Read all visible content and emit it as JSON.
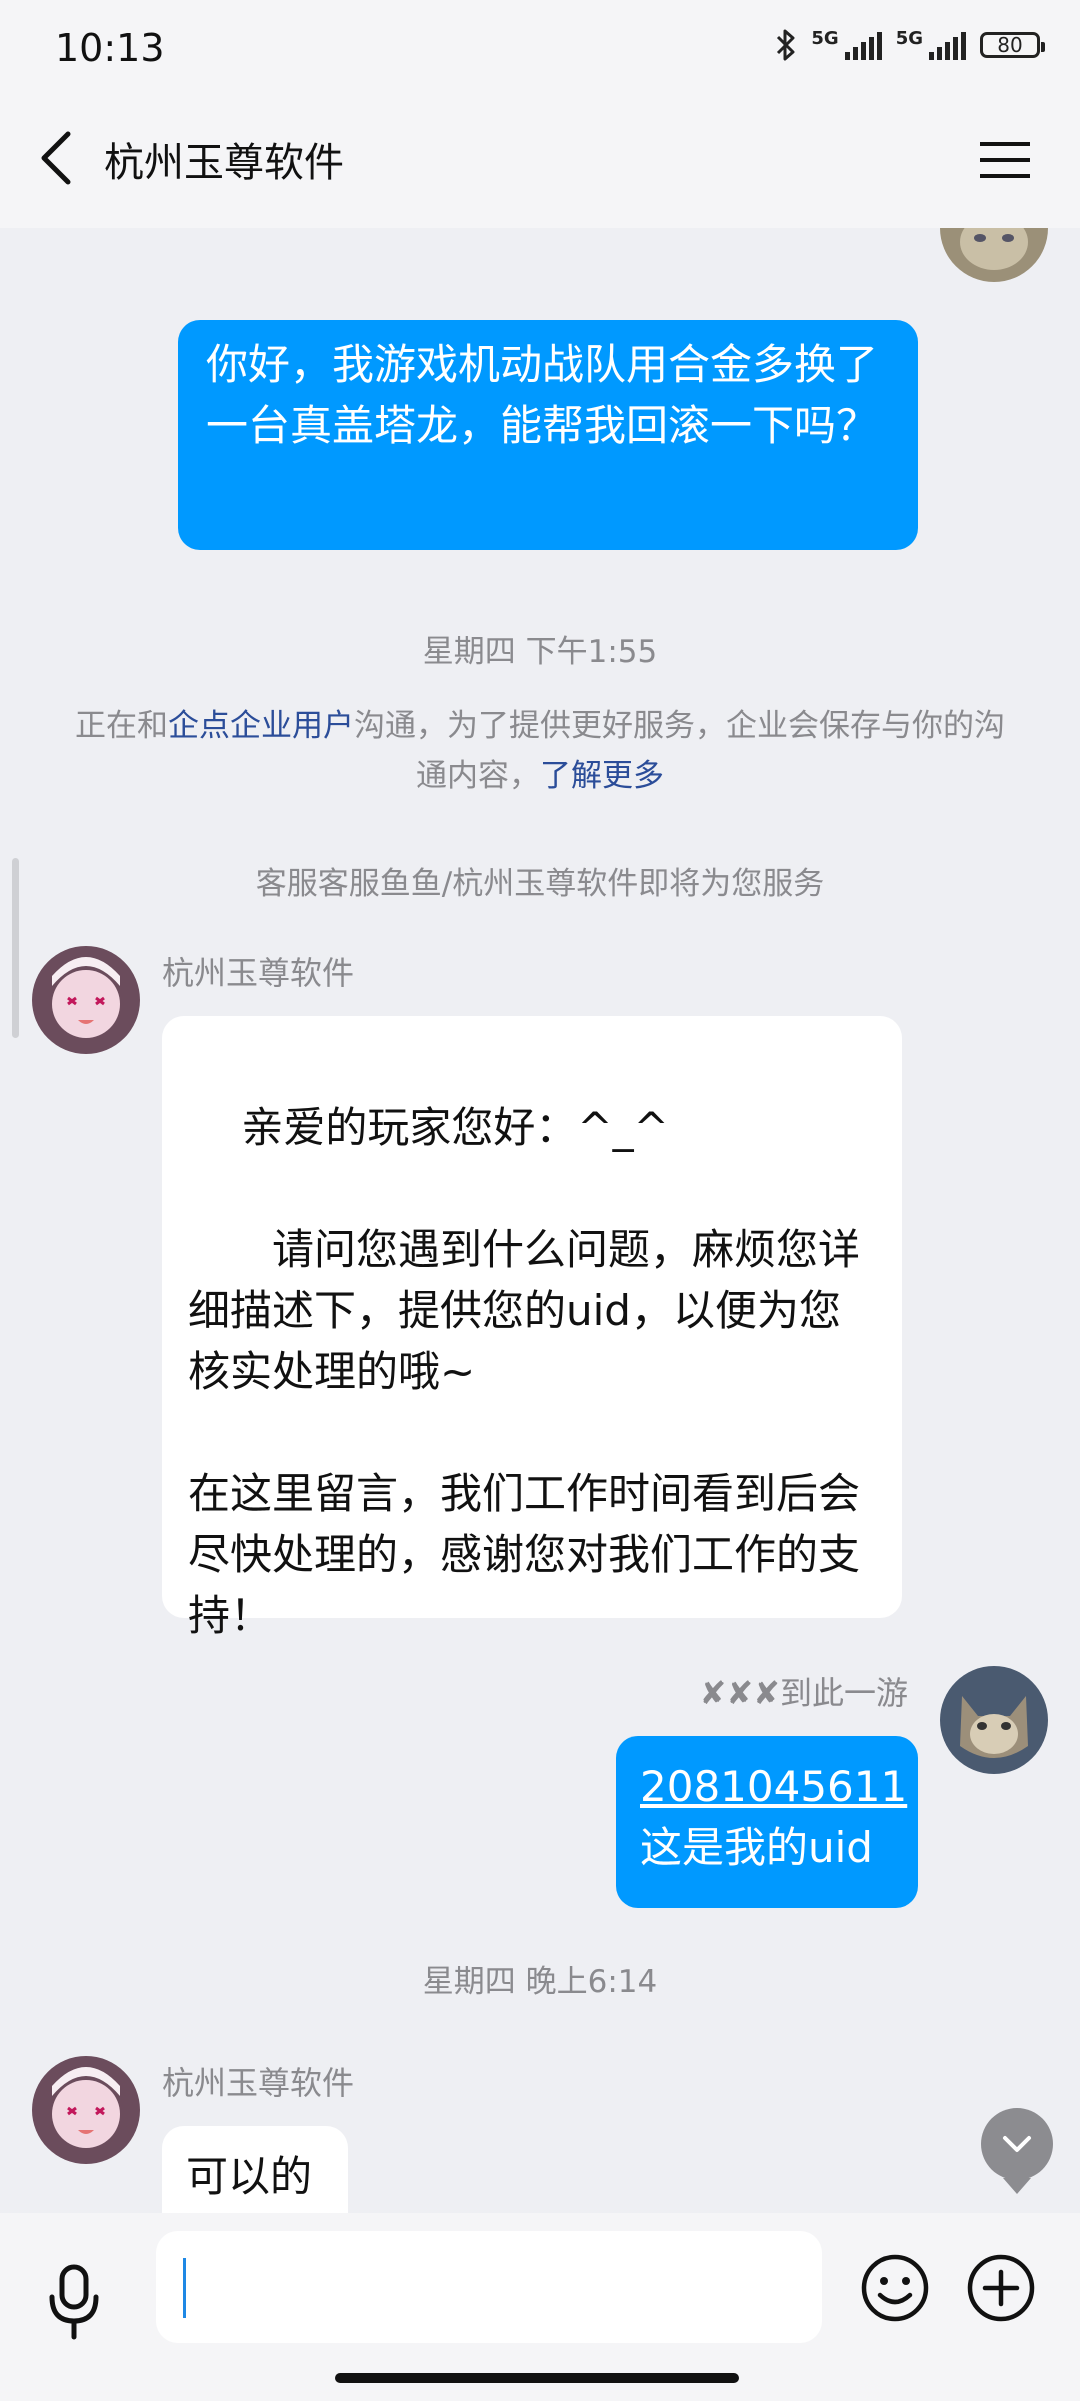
{
  "status_bar": {
    "time": "10:13",
    "network_1": "5G",
    "network_2": "5G",
    "battery": "80"
  },
  "header": {
    "title": "杭州玉尊软件"
  },
  "messages": {
    "first_outgoing": "你好，我游戏机动战队用合金多换了一台真盖塔龙，能帮我回滚一下吗？",
    "timestamp_1": "星期四 下午1:55",
    "notice_prefix": "正在和",
    "notice_link": "企点企业用户",
    "notice_middle": "沟通，为了提供更好服务，企业会保存与你的沟通内容，",
    "notice_more": "了解更多",
    "service_notice": "客服客服鱼鱼/杭州玉尊软件即将为您服务",
    "agent_name_1": "杭州玉尊软件",
    "agent_message_1": "亲爱的玩家您好：^_^\n\n　　请问您遇到什么问题，麻烦您详细描述下，提供您的uid，以便为您核实处理的哦~\n\n在这里留言，我们工作时间看到后会尽快处理的，感谢您对我们工作的支持！",
    "user_name": "✘✘✘到此一游",
    "uid_value": "2081045611",
    "uid_caption": "这是我的uid",
    "timestamp_2": "星期四 晚上6:14",
    "agent_name_2": "杭州玉尊软件",
    "agent_message_2": "可以的"
  },
  "input": {
    "placeholder": ""
  },
  "colors": {
    "outgoing_bubble": "#0099ff",
    "incoming_bubble": "#ffffff",
    "background": "#eeeff3",
    "link": "#2b4d99"
  }
}
